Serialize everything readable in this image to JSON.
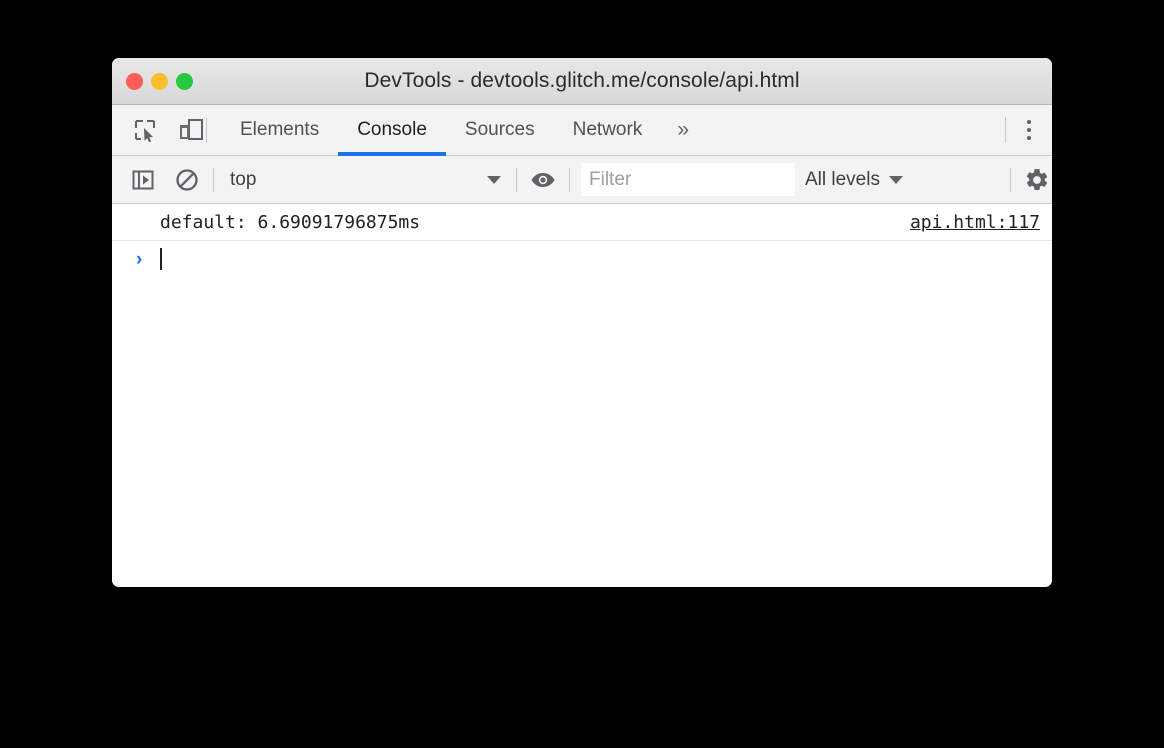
{
  "window": {
    "title": "DevTools - devtools.glitch.me/console/api.html",
    "traffic_lights": [
      {
        "name": "close",
        "color": "#ff5f57"
      },
      {
        "name": "minimize",
        "color": "#ffbd2e"
      },
      {
        "name": "maximize",
        "color": "#28c840"
      }
    ]
  },
  "tabbar": {
    "inspect_icon": "inspect-element-icon",
    "device_icon": "device-toolbar-icon",
    "tabs": [
      {
        "label": "Elements",
        "active": false
      },
      {
        "label": "Console",
        "active": true
      },
      {
        "label": "Sources",
        "active": false
      },
      {
        "label": "Network",
        "active": false
      }
    ],
    "overflow_label": "»",
    "menu_icon": "kebab-menu-icon",
    "active_underline_color": "#1a73e8"
  },
  "console_toolbar": {
    "sidebar_toggle_icon": "console-sidebar-toggle-icon",
    "clear_icon": "clear-console-icon",
    "context": {
      "value": "top",
      "caret": "▼"
    },
    "eye_icon": "live-expression-eye-icon",
    "filter": {
      "placeholder": "Filter",
      "value": ""
    },
    "levels": {
      "label": "All levels",
      "caret": "▼"
    },
    "settings_icon": "settings-gear-icon"
  },
  "console": {
    "messages": [
      {
        "text": "default: 6.69091796875ms",
        "source": "api.html:117"
      }
    ],
    "prompt": {
      "chevron": "›",
      "input_value": ""
    }
  }
}
